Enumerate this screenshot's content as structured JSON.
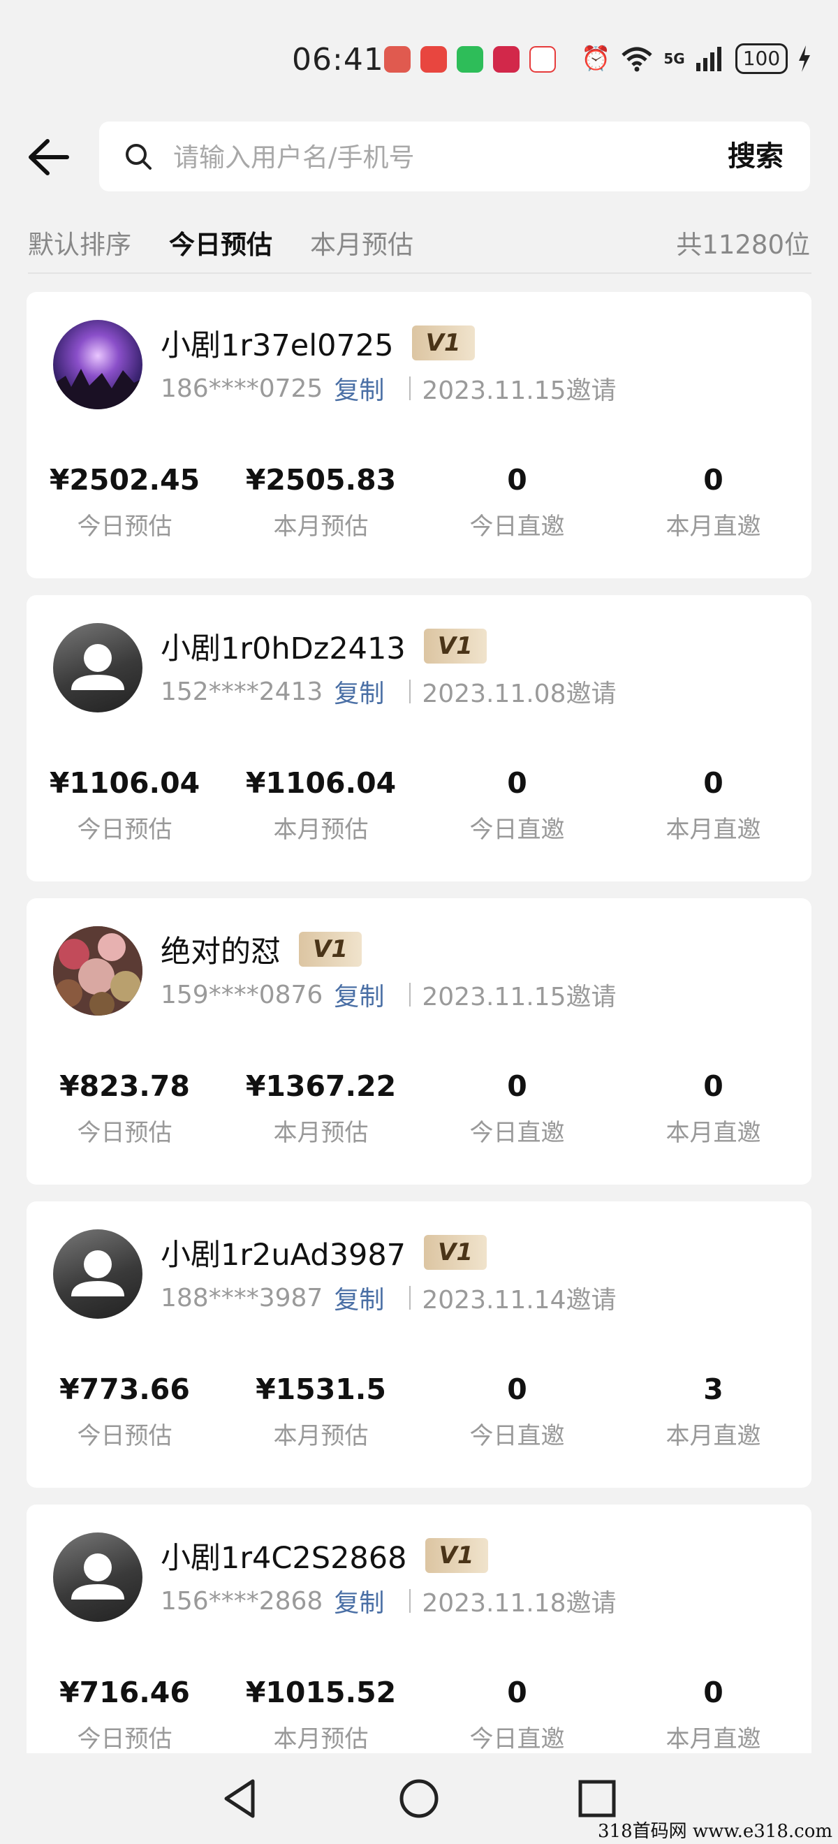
{
  "status_bar": {
    "time": "06:41",
    "network": "5G",
    "battery": "100",
    "app_icon_colors": [
      "#e05a4f",
      "#e8463f",
      "#2ebd59",
      "#d2284a",
      "#e63b3b"
    ]
  },
  "search": {
    "placeholder": "请输入用户名/手机号",
    "button_label": "搜索"
  },
  "tabs": {
    "items": [
      "默认排序",
      "今日预估",
      "本月预估"
    ],
    "active": "今日预估",
    "total": "共11280位"
  },
  "labels": {
    "copy": "复制",
    "today_est": "今日预估",
    "month_est": "本月预估",
    "today_invite": "今日直邀",
    "month_invite": "本月直邀"
  },
  "users": [
    {
      "name": "小剧1r37el0725",
      "level": "V1",
      "phone": "186****0725",
      "invite_date": "2023.11.15邀请",
      "avatar": "galaxy-photo",
      "today_est": "¥2502.45",
      "month_est": "¥2505.83",
      "today_invite": "0",
      "month_invite": "0"
    },
    {
      "name": "小剧1r0hDz2413",
      "level": "V1",
      "phone": "152****2413",
      "invite_date": "2023.11.08邀请",
      "avatar": "default-user",
      "today_est": "¥1106.04",
      "month_est": "¥1106.04",
      "today_invite": "0",
      "month_invite": "0"
    },
    {
      "name": "绝对的怼",
      "level": "V1",
      "phone": "159****0876",
      "invite_date": "2023.11.15邀请",
      "avatar": "food-photo",
      "today_est": "¥823.78",
      "month_est": "¥1367.22",
      "today_invite": "0",
      "month_invite": "0"
    },
    {
      "name": "小剧1r2uAd3987",
      "level": "V1",
      "phone": "188****3987",
      "invite_date": "2023.11.14邀请",
      "avatar": "default-user",
      "today_est": "¥773.66",
      "month_est": "¥1531.5",
      "today_invite": "0",
      "month_invite": "3"
    },
    {
      "name": "小剧1r4C2S2868",
      "level": "V1",
      "phone": "156****2868",
      "invite_date": "2023.11.18邀请",
      "avatar": "default-user",
      "today_est": "¥716.46",
      "month_est": "¥1015.52",
      "today_invite": "0",
      "month_invite": "0"
    }
  ],
  "watermark": "318首码网 www.e318.com"
}
